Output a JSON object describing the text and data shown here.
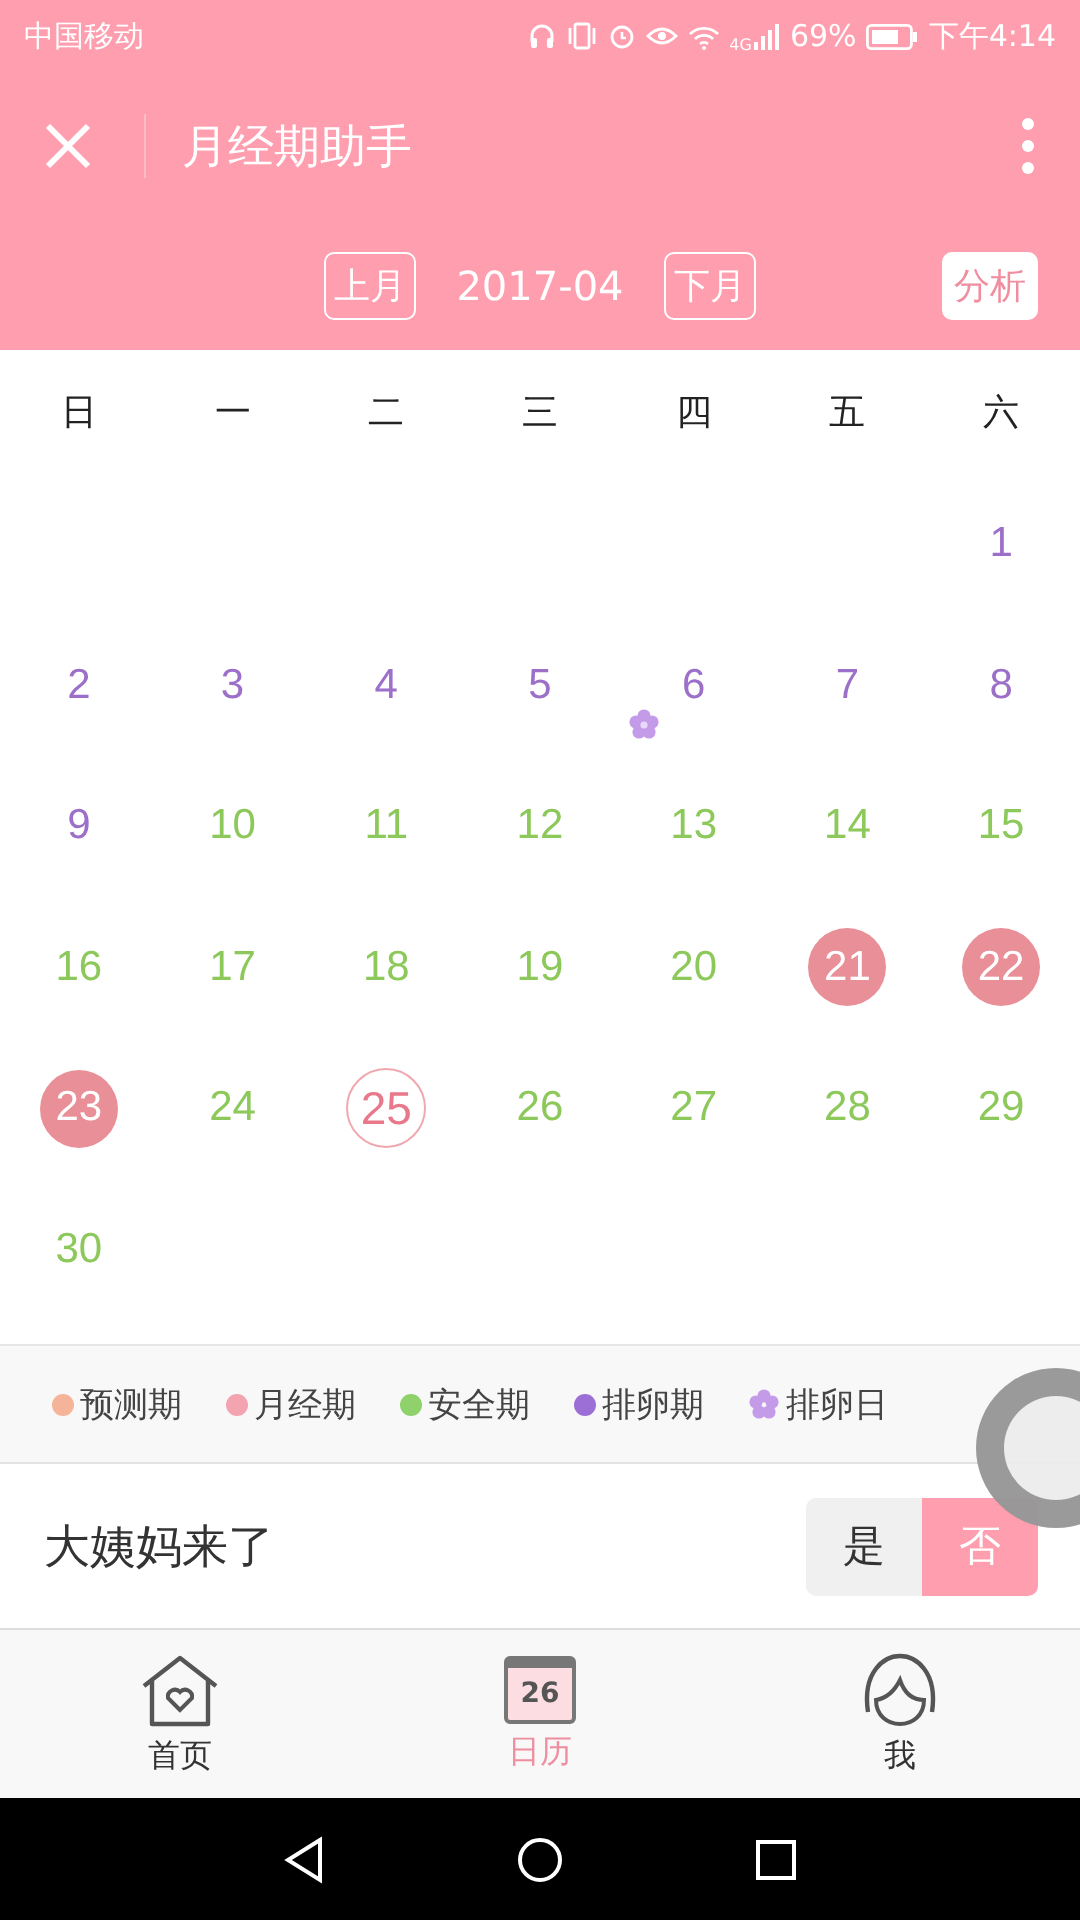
{
  "status_bar": {
    "carrier": "中国移动",
    "network": "4G",
    "battery": "69%",
    "time": "下午4:14"
  },
  "header": {
    "title": "月经期助手"
  },
  "month_bar": {
    "prev": "上月",
    "month": "2017-04",
    "next": "下月",
    "analysis": "分析"
  },
  "weekdays": [
    "日",
    "一",
    "二",
    "三",
    "四",
    "五",
    "六"
  ],
  "weeks": [
    {
      "days": [
        {
          "kind": "blank"
        },
        {
          "kind": "blank"
        },
        {
          "kind": "blank"
        },
        {
          "kind": "blank"
        },
        {
          "kind": "blank"
        },
        {
          "kind": "blank"
        },
        {
          "kind": "ovulation",
          "day": "1"
        }
      ]
    },
    {
      "days": [
        {
          "kind": "ovulation",
          "day": "2"
        },
        {
          "kind": "ovulation",
          "day": "3"
        },
        {
          "kind": "ovulation",
          "day": "4"
        },
        {
          "kind": "ovulation",
          "day": "5"
        },
        {
          "kind": "ovulation",
          "day": "6",
          "ovulation_day": true
        },
        {
          "kind": "ovulation",
          "day": "7"
        },
        {
          "kind": "ovulation",
          "day": "8"
        }
      ]
    },
    {
      "days": [
        {
          "kind": "ovulation",
          "day": "9"
        },
        {
          "kind": "safe",
          "day": "10"
        },
        {
          "kind": "safe",
          "day": "11"
        },
        {
          "kind": "safe",
          "day": "12"
        },
        {
          "kind": "safe",
          "day": "13"
        },
        {
          "kind": "safe",
          "day": "14"
        },
        {
          "kind": "safe",
          "day": "15"
        }
      ]
    },
    {
      "days": [
        {
          "kind": "safe",
          "day": "16"
        },
        {
          "kind": "safe",
          "day": "17"
        },
        {
          "kind": "safe",
          "day": "18"
        },
        {
          "kind": "safe",
          "day": "19"
        },
        {
          "kind": "safe",
          "day": "20"
        },
        {
          "kind": "period",
          "day": "21"
        },
        {
          "kind": "period",
          "day": "22"
        }
      ]
    },
    {
      "days": [
        {
          "kind": "period",
          "day": "23"
        },
        {
          "kind": "safe",
          "day": "24"
        },
        {
          "kind": "today",
          "day": "25"
        },
        {
          "kind": "safe",
          "day": "26"
        },
        {
          "kind": "safe",
          "day": "27"
        },
        {
          "kind": "safe",
          "day": "28"
        },
        {
          "kind": "safe",
          "day": "29"
        }
      ]
    },
    {
      "days": [
        {
          "kind": "safe",
          "day": "30"
        }
      ]
    }
  ],
  "legend": [
    {
      "kind": "dot",
      "label": "预测期",
      "color": "#f5b49a"
    },
    {
      "kind": "dot",
      "label": "月经期",
      "color": "#f4a3b0"
    },
    {
      "kind": "dot",
      "label": "安全期",
      "color": "#8fd16a"
    },
    {
      "kind": "dot",
      "label": "排卵期",
      "color": "#9c6fd6"
    },
    {
      "kind": "flower",
      "label": "排卵日",
      "color": "#c49be8"
    }
  ],
  "period_question": {
    "label": "大姨妈来了",
    "options": [
      {
        "label": "是",
        "selected": false
      },
      {
        "label": "否",
        "selected": true
      }
    ]
  },
  "tabs": [
    {
      "label": "首页",
      "selected": false
    },
    {
      "label": "日历",
      "badge": "26",
      "selected": true
    },
    {
      "label": "我",
      "selected": false
    }
  ]
}
